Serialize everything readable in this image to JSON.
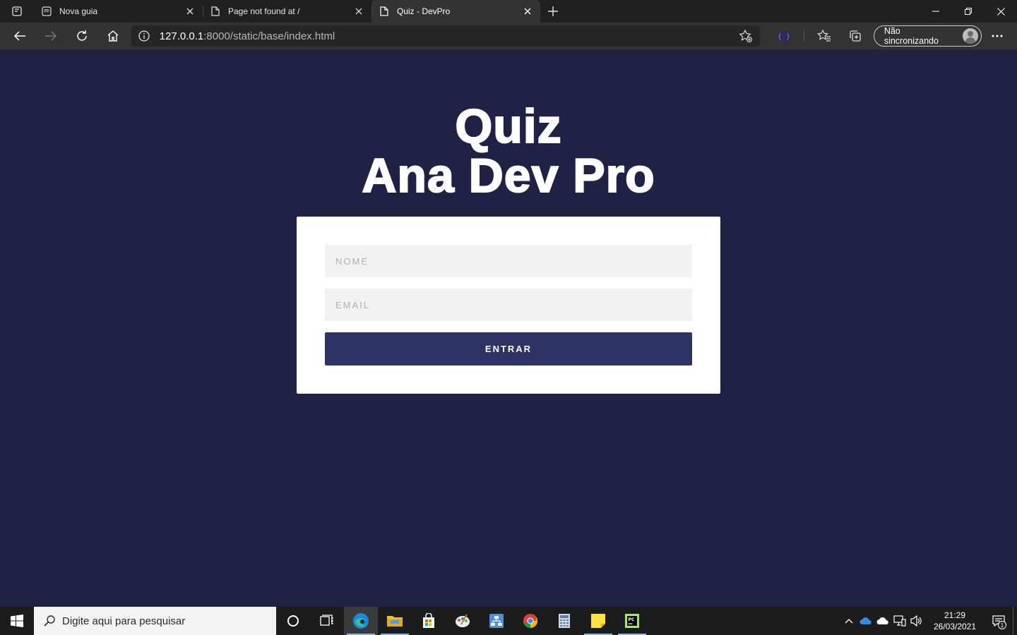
{
  "browser": {
    "tabs": [
      {
        "title": "Nova guia",
        "icon": "new-tab-page-icon",
        "active": false
      },
      {
        "title": "Page not found at /",
        "icon": "document-icon",
        "active": false
      },
      {
        "title": "Quiz - DevPro",
        "icon": "document-icon",
        "active": true
      }
    ],
    "address": {
      "host": "127.0.0.1",
      "rest": ":8000/static/base/index.html"
    },
    "profile_label": "Não sincronizando"
  },
  "page": {
    "title_line1": "Quiz",
    "title_line2": "Ana Dev Pro",
    "form": {
      "name_placeholder": "NOME",
      "email_placeholder": "EMAIL",
      "submit_label": "ENTRAR"
    },
    "colors": {
      "background": "#1f2244",
      "button": "#2d3365",
      "card": "#ffffff"
    }
  },
  "taskbar": {
    "search_placeholder": "Digite aqui para pesquisar",
    "time": "21:29",
    "date": "26/03/2021",
    "notification_count": "1"
  }
}
